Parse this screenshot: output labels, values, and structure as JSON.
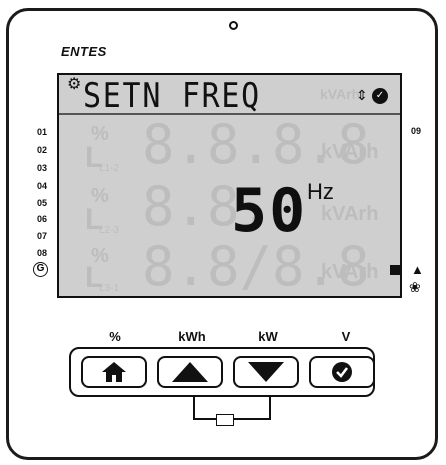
{
  "brand": "ENTES",
  "display": {
    "message": "SETN FREQ",
    "value": "50",
    "unit": "Hz",
    "ghost_top": "kVArh",
    "row_ghost_unit": "kVArh",
    "row_labels": [
      "L1-2",
      "L2-3",
      "L3-1"
    ]
  },
  "channels": {
    "left": [
      "01",
      "02",
      "03",
      "04",
      "05",
      "06",
      "07",
      "08"
    ],
    "right": "09",
    "g": "G"
  },
  "keys": [
    {
      "label": "%",
      "icon": "home-icon"
    },
    {
      "label": "kWh",
      "icon": "up-arrow-icon"
    },
    {
      "label": "kW",
      "icon": "down-arrow-icon"
    },
    {
      "label": "V",
      "icon": "check-icon"
    }
  ],
  "colors": {
    "lcd_bg": "#cfcfcf",
    "segment_off": "#bdbdbd",
    "segment_on": "#111111"
  }
}
